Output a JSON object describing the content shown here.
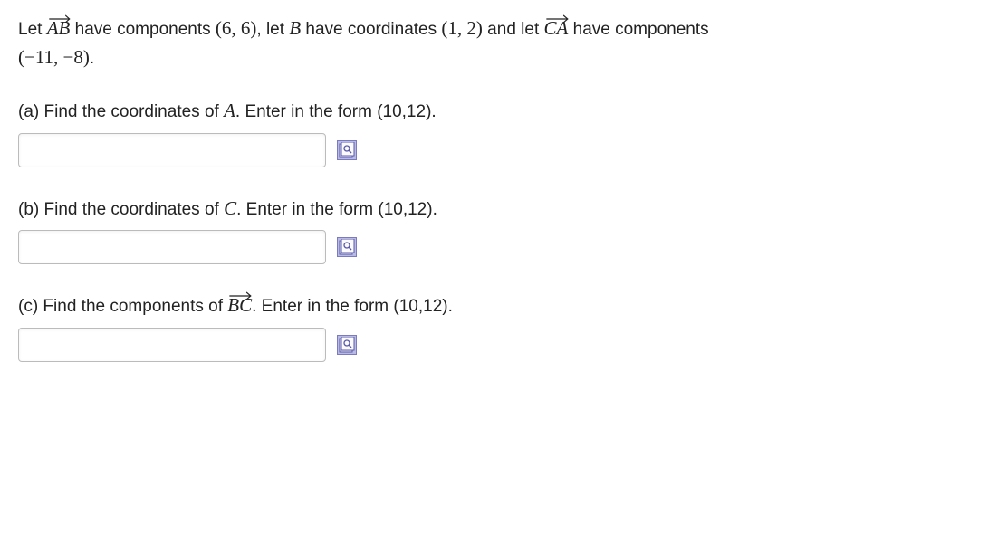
{
  "intro": {
    "let_text": "Let ",
    "vec_ab": "AB",
    "have_components_text": " have components ",
    "ab_components": "(6, 6)",
    "let_b_text": ", let ",
    "b_var": "B",
    "have_coords_text": " have coordinates ",
    "b_coords": "(1, 2)",
    "and_let_text": " and let ",
    "vec_ca": "CA",
    "have_components_text2": " have components ",
    "ca_components": "(−11, −8)",
    "period": "."
  },
  "questions": {
    "a": {
      "label_prefix": "(a) Find the coordinates of ",
      "var": "A",
      "label_suffix": ". Enter in the form (10,12).",
      "value": ""
    },
    "b": {
      "label_prefix": "(b) Find the coordinates of ",
      "var": "C",
      "label_suffix": ". Enter in the form (10,12).",
      "value": ""
    },
    "c": {
      "label_prefix": "(c) Find the components of ",
      "vec": "BC",
      "label_suffix": ". Enter in the form (10,12).",
      "value": ""
    }
  }
}
